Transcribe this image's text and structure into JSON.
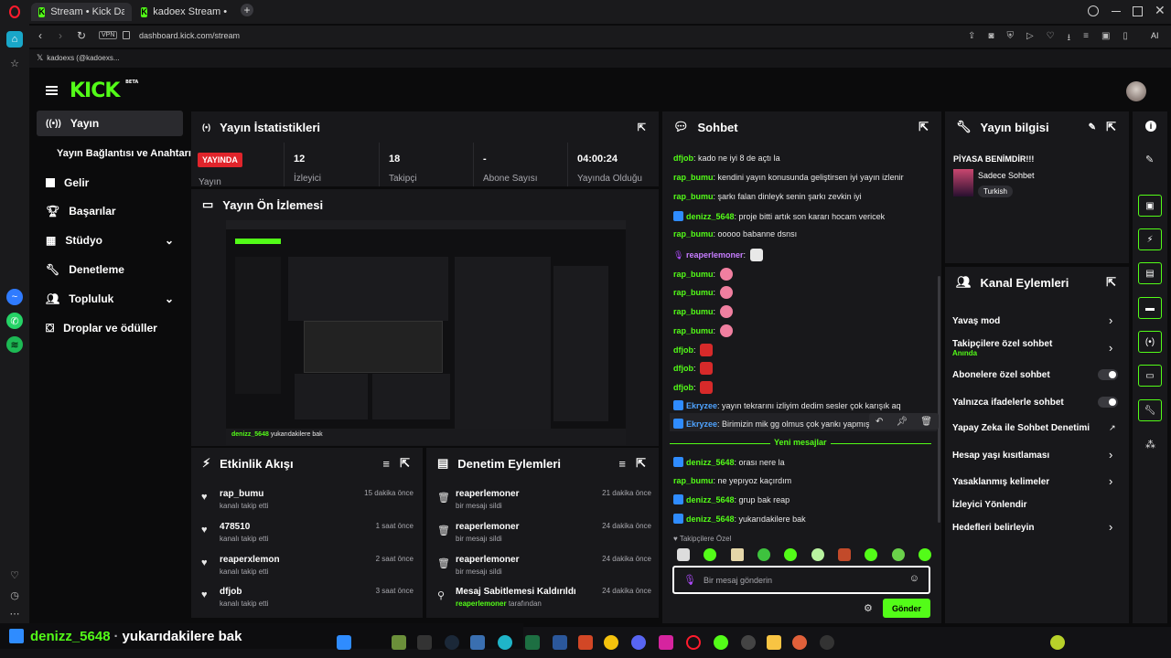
{
  "browser": {
    "tabs": [
      {
        "label": "Stream • Kick Dashboard",
        "active": true
      },
      {
        "label": "kadoex Stream • Watch Li",
        "active": false
      }
    ],
    "new_tab": "+",
    "url": "dashboard.kick.com/stream",
    "vpn": "VPN",
    "ai_label": "AI",
    "bookmark": "kadoexs (@kadoexs..."
  },
  "kick": {
    "logo": "KICK",
    "logo_tag": "BETA",
    "nav": [
      {
        "label": "Yayın",
        "active": true,
        "icon": "broadcast-icon"
      },
      {
        "label": "Yayın Bağlantısı ve Anahtarı",
        "sub": true
      },
      {
        "label": "Gelir",
        "icon": "chart-icon"
      },
      {
        "label": "Başarılar",
        "icon": "trophy-icon"
      },
      {
        "label": "Stüdyo",
        "icon": "grid-icon",
        "expand": true
      },
      {
        "label": "Denetleme",
        "icon": "wrench-icon"
      },
      {
        "label": "Topluluk",
        "icon": "people-icon",
        "expand": true
      },
      {
        "label": "Droplar ve ödüller",
        "icon": "gift-icon"
      }
    ],
    "stats": {
      "title": "Yayın İstatistikleri",
      "live_badge": "YAYINDA",
      "live_label": "Yayın",
      "items": [
        {
          "value": "12",
          "label": "İzleyici"
        },
        {
          "value": "18",
          "label": "Takipçi"
        },
        {
          "value": "-",
          "label": "Abone Sayısı"
        },
        {
          "value": "04:00:24",
          "label": "Yayında Olduğu"
        }
      ]
    },
    "preview": {
      "title": "Yayın Ön İzlemesi",
      "overlay_user": "denizz_5648",
      "overlay_text": "yukarıdakilere bak"
    },
    "activity": {
      "title": "Etkinlik Akışı",
      "items": [
        {
          "name": "rap_bumu",
          "sub": "kanalı takip etti",
          "time": "15 dakika önce"
        },
        {
          "name": "478510",
          "sub": "kanalı takip etti",
          "time": "1 saat önce"
        },
        {
          "name": "reaperxlemon",
          "sub": "kanalı takip etti",
          "time": "2 saat önce"
        },
        {
          "name": "dfjob",
          "sub": "kanalı takip etti",
          "time": "3 saat önce"
        }
      ]
    },
    "moderation": {
      "title": "Denetim Eylemleri",
      "items": [
        {
          "name": "reaperlemoner",
          "sub": "bir mesajı sildi",
          "time": "21 dakika önce"
        },
        {
          "name": "reaperlemoner",
          "sub": "bir mesajı sildi",
          "time": "24 dakika önce"
        },
        {
          "name": "reaperlemoner",
          "sub": "bir mesajı sildi",
          "time": "24 dakika önce"
        },
        {
          "name": "Mesaj Sabitlemesi Kaldırıldı",
          "sub_user": "reaperlemoner",
          "sub": "tarafından",
          "time": "24 dakika önce"
        }
      ]
    },
    "chat": {
      "title": "Sohbet",
      "messages": [
        {
          "user": "dfjob",
          "text": "kado ne iyi 8 de açtı la"
        },
        {
          "user": "rap_bumu",
          "text": "kendini yayın konusunda geliştirsen iyi yayın izlenir"
        },
        {
          "user": "rap_bumu",
          "text": "şarkı falan dinleyk senin şarkı zevkin iyi"
        },
        {
          "user": "denizz_5648",
          "text": "proje bitti artık son kararı hocam vericek",
          "badge": true
        },
        {
          "user": "rap_bumu",
          "text": "ooooo babanne dsnsı"
        },
        {
          "user": "reaperlemoner",
          "text": "",
          "mod": true,
          "emotes": 1
        },
        {
          "user": "rap_bumu",
          "text": "",
          "emotes": 1
        },
        {
          "user": "rap_bumu",
          "text": "",
          "emotes": 1
        },
        {
          "user": "rap_bumu",
          "text": "",
          "emotes": 1
        },
        {
          "user": "rap_bumu",
          "text": "",
          "emotes": 1
        },
        {
          "user": "dfjob",
          "text": "",
          "emotes": 1
        },
        {
          "user": "dfjob",
          "text": "",
          "emotes": 1
        },
        {
          "user": "dfjob",
          "text": "",
          "emotes": 1
        },
        {
          "user": "Ekryzee",
          "text": "yayın tekrarını izliyim dedim sesler çok karışık aq",
          "badge": true,
          "blue": true
        },
        {
          "user": "Ekryzee",
          "text": "Birimizin mik gg olmus çok yankı yapmış",
          "badge": true,
          "blue": true
        }
      ],
      "new_messages": "Yeni mesajlar",
      "new_msgs": [
        {
          "user": "denizz_5648",
          "text": "orası nere la",
          "badge": true
        },
        {
          "user": "rap_bumu",
          "text": "ne yepıyoz kaçırdım"
        },
        {
          "user": "denizz_5648",
          "text": "grup bak reap",
          "badge": true
        },
        {
          "user": "denizz_5648",
          "text": "yukarıdakilere bak",
          "badge": true
        }
      ],
      "follower_emotes_label": "Takipçilere Özel",
      "input_placeholder": "Bir mesaj gönderin",
      "send": "Gönder"
    },
    "stream_info": {
      "title": "Yayın bilgisi",
      "stream_title": "PİYASA BENİMDİR!!!",
      "category": "Sadece Sohbet",
      "language": "Turkish"
    },
    "channel_actions": {
      "title": "Kanal Eylemleri",
      "items": [
        {
          "label": "Yavaş mod",
          "control": "chevron"
        },
        {
          "label": "Takipçilere özel sohbet",
          "sub": "Anında",
          "control": "chevron"
        },
        {
          "label": "Abonelere özel sohbet",
          "control": "toggle"
        },
        {
          "label": "Yalnızca ifadelerle sohbet",
          "control": "toggle"
        },
        {
          "label": "Yapay Zeka ile Sohbet Denetimi",
          "control": "external"
        },
        {
          "label": "Hesap yaşı kısıtlaması",
          "control": "chevron"
        },
        {
          "label": "Yasaklanmış kelimeler",
          "control": "chevron"
        },
        {
          "label": "İzleyici Yönlendir",
          "control": "none"
        },
        {
          "label": "Hedefleri belirleyin",
          "control": "chevron"
        }
      ]
    }
  },
  "overlay_bottom": {
    "user": "denizz_5648",
    "sep": "·",
    "text": "yukarıdakilere bak"
  },
  "colors": {
    "accent": "#53fc18",
    "panel": "#18181b",
    "live": "#e0242b"
  }
}
